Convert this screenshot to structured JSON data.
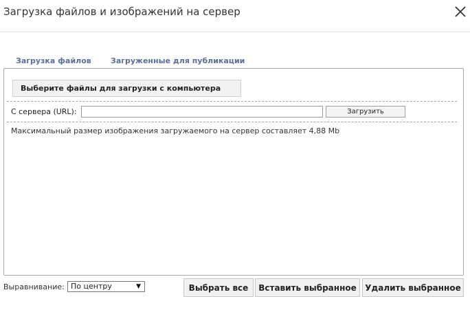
{
  "dialog": {
    "title": "Загрузка файлов и изображений на сервер"
  },
  "tabs": [
    {
      "label": "Загрузка файлов"
    },
    {
      "label": "Загруженные для публикации"
    }
  ],
  "upload": {
    "choose_files_label": "Выберите файлы для загрузки с компьютера",
    "url_label": "С сервера (URL):",
    "url_value": "",
    "url_button_label": "Загрузить",
    "max_size_text": "Максимальный размер изображения загружаемого на сервер составляет 4,88 Mb"
  },
  "footer": {
    "align_label": "Выравнивание:",
    "align_value": "По центру",
    "select_all_label": "Выбрать все",
    "insert_selected_label": "Вставить выбранное",
    "delete_selected_label": "Удалить выбранное"
  },
  "icons": {
    "close": "close-icon",
    "dropdown": "chevron-down-icon"
  }
}
